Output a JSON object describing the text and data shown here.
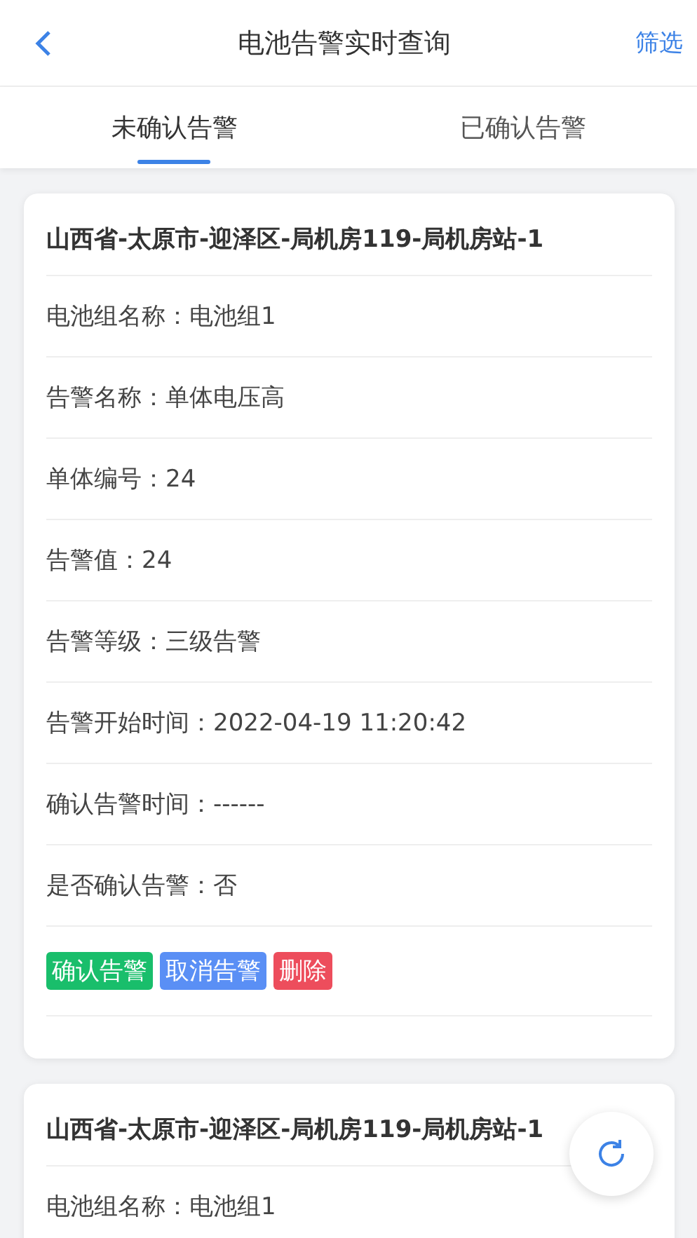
{
  "header": {
    "title": "电池告警实时查询",
    "action": "筛选"
  },
  "tabs": [
    {
      "label": "未确认告警",
      "selected": true
    },
    {
      "label": "已确认告警",
      "selected": false
    }
  ],
  "cards": [
    {
      "title": "山西省-太原市-迎泽区-局机房119-局机房站-1",
      "rows": [
        "电池组名称：电池组1",
        "告警名称：单体电压高",
        "单体编号：24",
        "告警值：24",
        "告警等级：三级告警",
        "告警开始时间：2022-04-19 11:20:42",
        "确认告警时间：------",
        "是否确认告警：否"
      ],
      "buttons": [
        {
          "label": "确认告警",
          "kind": "confirm"
        },
        {
          "label": "取消告警",
          "kind": "cancel"
        },
        {
          "label": "删除",
          "kind": "delete"
        }
      ]
    },
    {
      "title": "山西省-太原市-迎泽区-局机房119-局机房站-1",
      "rows": [
        "电池组名称：电池组1"
      ]
    }
  ]
}
